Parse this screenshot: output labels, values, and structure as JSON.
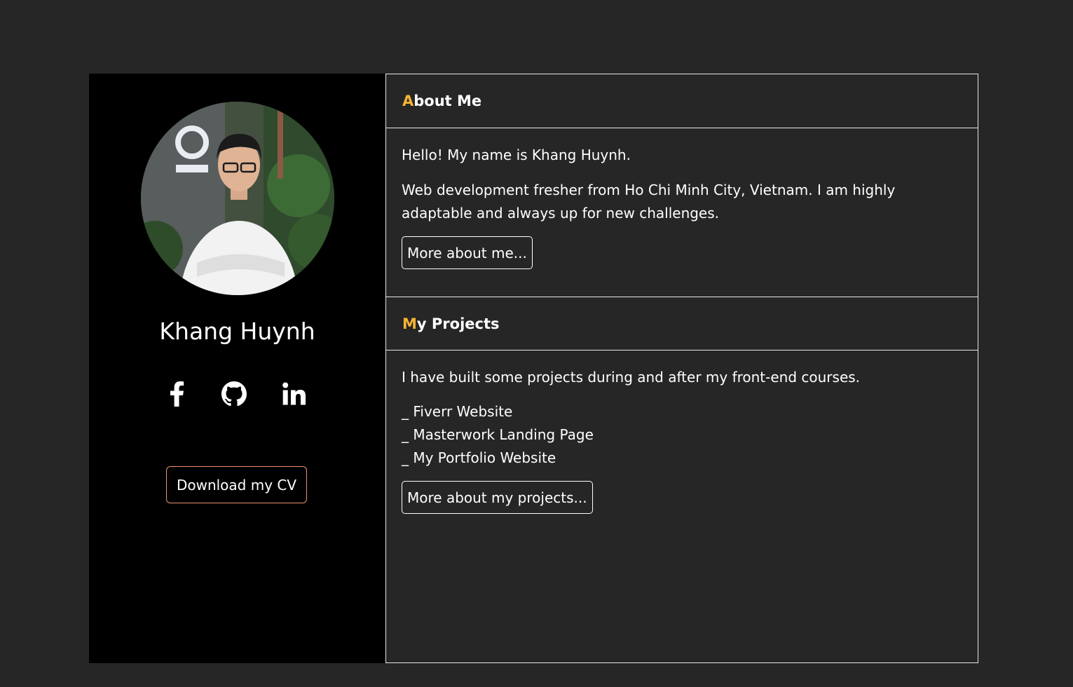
{
  "profile": {
    "name": "Khang Huynh",
    "cv_button_label": "Download my CV",
    "socials": [
      {
        "icon": "facebook-icon"
      },
      {
        "icon": "github-icon"
      },
      {
        "icon": "linkedin-icon"
      }
    ]
  },
  "about": {
    "title_first_letter": "A",
    "title_rest": "bout Me",
    "greeting": "Hello! My name is Khang Huynh.",
    "description": "Web development fresher from Ho Chi Minh City, Vietnam. I am highly adaptable and always up for new challenges.",
    "button_label": "More about me..."
  },
  "projects": {
    "title_first_letter": "M",
    "title_rest": "y Projects",
    "intro": "I have built some projects during and after my front-end courses.",
    "items": [
      "_ Fiverr Website",
      "_ Masterwork Landing Page",
      "_ My Portfolio Website"
    ],
    "button_label": "More about my projects..."
  },
  "colors": {
    "page_background": "#262626",
    "sidebar_background": "#000000",
    "accent": "#f5b335",
    "cv_border": "#e8936f"
  }
}
